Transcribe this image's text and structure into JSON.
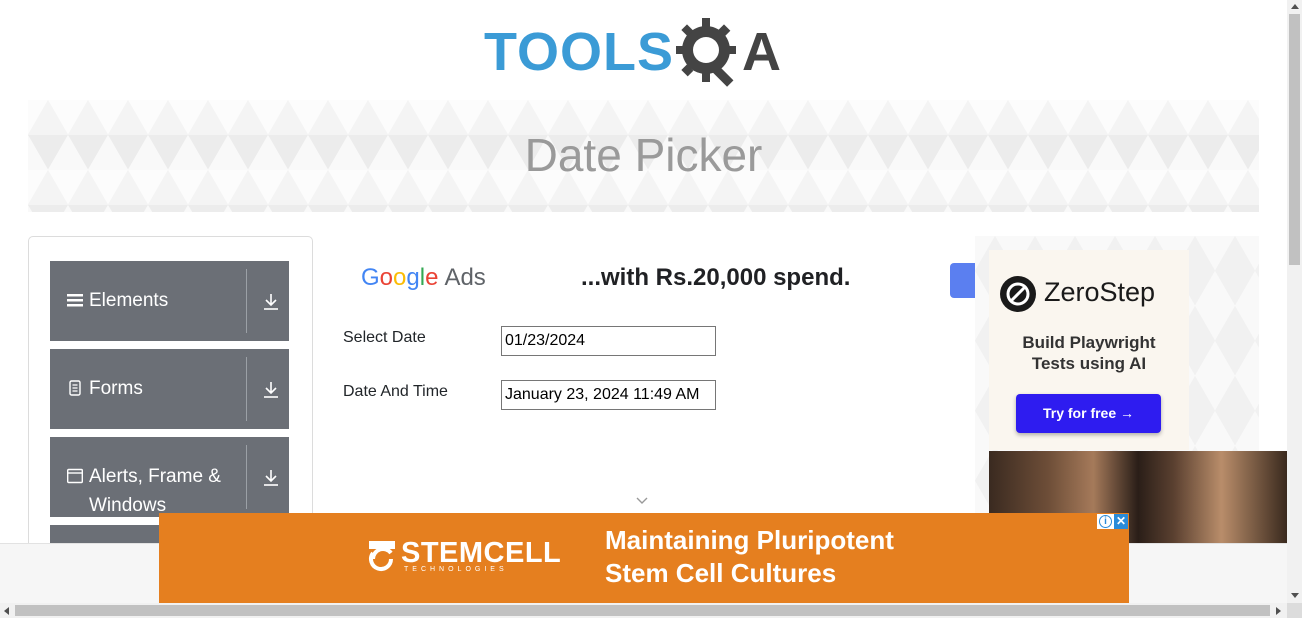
{
  "logo": {
    "text_part1": "TOOLS",
    "text_part2": "A",
    "colors": {
      "blue": "#3b9bd6",
      "dark": "#444444"
    }
  },
  "banner": {
    "title": "Date Picker"
  },
  "sidebar": {
    "groups": [
      {
        "label": "Elements",
        "icon": "hamburger-icon"
      },
      {
        "label": "Forms",
        "icon": "document-icon"
      },
      {
        "label": "Alerts, Frame & Windows",
        "icon": "window-icon"
      }
    ]
  },
  "google_ad": {
    "brand_letters": [
      "G",
      "o",
      "o",
      "g",
      "l",
      "e"
    ],
    "brand_suffix": "Ads",
    "slogan": "...with Rs.20,000 spend."
  },
  "form": {
    "select_date": {
      "label": "Select Date",
      "value": "01/23/2024"
    },
    "date_and_time": {
      "label": "Date And Time",
      "value": "January 23, 2024 11:49 AM"
    }
  },
  "right_ad": {
    "brand": "ZeroStep",
    "tagline_line1": "Build Playwright",
    "tagline_line2": "Tests using AI",
    "cta": "Try for free →",
    "cta_color": "#2e1cf0"
  },
  "bottom_ad": {
    "brand": "STEMCELL",
    "brand_sub": "TECHNOLOGIES",
    "headline_line1": "Maintaining Pluripotent",
    "headline_line2": "Stem Cell Cultures",
    "background": "#e57f1f",
    "adchoices_info": "i",
    "adchoices_close": "✕"
  }
}
